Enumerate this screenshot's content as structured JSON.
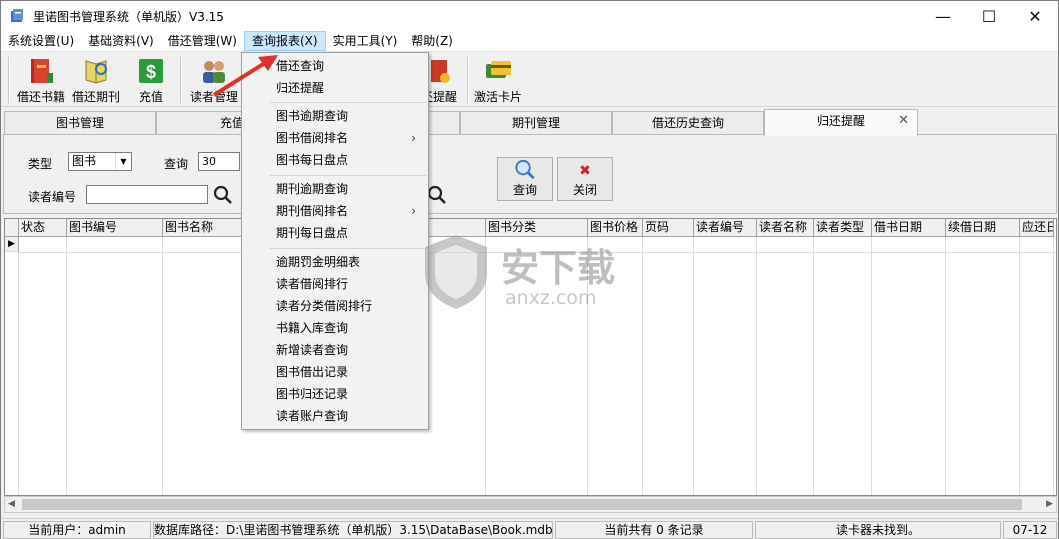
{
  "window": {
    "title": "里诺图书管理系统（单机版）V3.15",
    "minimize": "—",
    "maximize": "☐",
    "close": "✕"
  },
  "menu": [
    "系统设置(U)",
    "基础资料(V)",
    "借还管理(W)",
    "查询报表(X)",
    "实用工具(Y)",
    "帮助(Z)"
  ],
  "toolbar": {
    "borrow_book": "借还书籍",
    "borrow_journal": "借还期刊",
    "recharge": "充值",
    "reader_mgmt": "读者管理",
    "return_remind": "还提醒",
    "activate_card": "激活卡片"
  },
  "tabs": [
    "图书管理",
    "充值",
    "期刊管理",
    "借还历史查询",
    "归还提醒"
  ],
  "tab_close": "✕",
  "filter": {
    "type_label": "类型",
    "type_value": "图书",
    "query_label": "查询",
    "query_value": "30",
    "reader_label": "读者编号",
    "reader_value": "",
    "query_button": "查询",
    "close_button": "关闭",
    "close_icon_glyph": "✖"
  },
  "columns": [
    "状态",
    "图书编号",
    "图书名称",
    "图书分类",
    "图书价格",
    "页码",
    "读者编号",
    "读者名称",
    "读者类型",
    "借书日期",
    "续借日期",
    "应还日"
  ],
  "row_indicator": "▶",
  "scroll": {
    "left": "◀",
    "right": "▶"
  },
  "dropdown": {
    "group1": [
      "借还查询",
      "归还提醒"
    ],
    "group2": [
      "图书逾期查询",
      "图书借阅排名",
      "图书每日盘点"
    ],
    "group3": [
      "期刊逾期查询",
      "期刊借阅排名",
      "期刊每日盘点"
    ],
    "group4": [
      "逾期罚金明细表",
      "读者借阅排行",
      "读者分类借阅排行",
      "书籍入库查询",
      "新增读者查询",
      "图书借出记录",
      "图书归还记录",
      "读者账户查询"
    ],
    "submenu_arrow": "›"
  },
  "status": {
    "user": "当前用户：admin",
    "db": "数据库路径：D:\\里诺图书管理系统（单机版）3.15\\DataBase\\Book.mdb",
    "records": "当前共有 0 条记录",
    "reader": "读卡器未找到。",
    "date": "07-12"
  },
  "watermark": {
    "text": "安下载",
    "sub": "anxz.com"
  },
  "colors": {
    "menu_highlight": "#cce8ff",
    "arrow": "#e0302a"
  }
}
